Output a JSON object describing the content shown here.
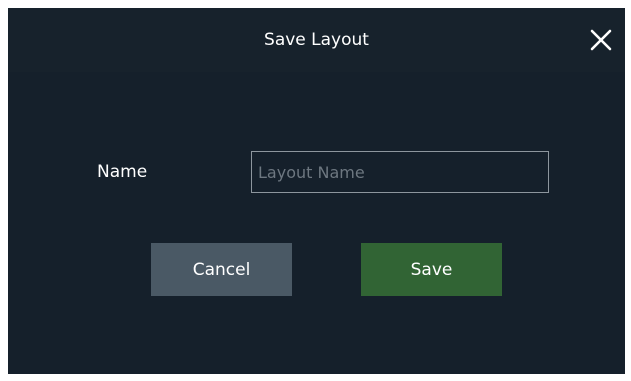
{
  "dialog": {
    "title": "Save Layout",
    "close_icon": "close-icon"
  },
  "form": {
    "name_label": "Name",
    "name_value": "",
    "name_placeholder": "Layout Name"
  },
  "buttons": {
    "cancel_label": "Cancel",
    "save_label": "Save"
  },
  "colors": {
    "background": "#15202b",
    "cancel_button": "#4a5965",
    "save_button": "#316434",
    "input_border": "#8d969e",
    "text": "#ffffff"
  }
}
